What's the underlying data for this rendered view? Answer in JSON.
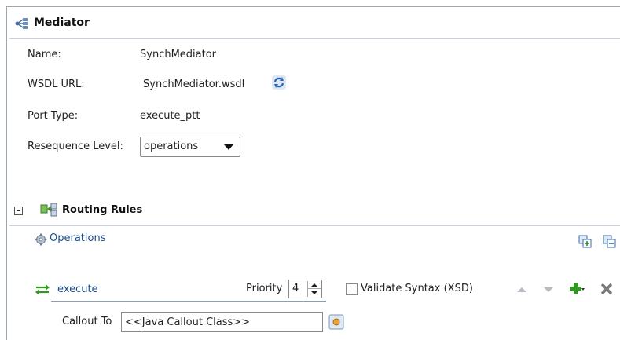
{
  "mediator": {
    "title": "Mediator",
    "fields": {
      "name_label": "Name:",
      "name_value": "SynchMediator",
      "wsdl_label": "WSDL URL:",
      "wsdl_value": "SynchMediator.wsdl",
      "port_label": "Port Type:",
      "port_value": "execute_ptt",
      "resequence_label": "Resequence Level:",
      "resequence_value": "operations"
    }
  },
  "routing": {
    "title": "Routing Rules",
    "operations_label": "Operations",
    "rule": {
      "operation": "execute",
      "priority_label": "Priority",
      "priority_value": "4",
      "validate_label": "Validate Syntax (XSD)",
      "validate_checked": false,
      "callout_label": "Callout To",
      "callout_value": "<<Java Callout Class>>"
    }
  },
  "icons": {
    "mediator": "mediator-icon",
    "refresh": "refresh-wsdl-icon",
    "routing": "routing-rules-icon",
    "operations": "gear-icon",
    "expand_all": "expand-all-icon",
    "collapse_all": "collapse-all-icon",
    "execute": "two-way-arrows-icon",
    "add": "add-icon",
    "delete": "delete-icon",
    "browse": "browse-icon"
  },
  "colors": {
    "link": "#1b4e8c",
    "add_green": "#2e9a1e",
    "border": "#9aa6b2"
  }
}
